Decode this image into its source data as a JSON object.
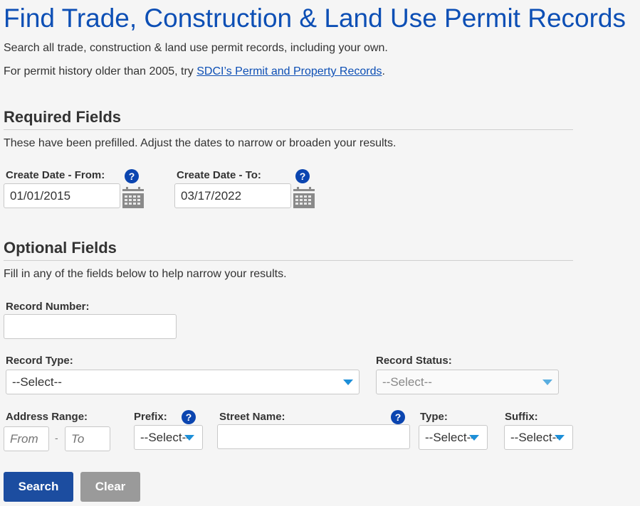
{
  "page": {
    "title": "Find Trade, Construction & Land Use Permit Records",
    "intro": "Search all trade, construction & land use permit records, including your own.",
    "history_prefix": "For permit history older than 2005, try ",
    "history_link": "SDCI’s Permit and Property Records",
    "history_suffix": "."
  },
  "required": {
    "heading": "Required Fields",
    "description": "These have been prefilled. Adjust the dates to narrow or broaden your results.",
    "date_from": {
      "label": "Create Date - From:",
      "value": "01/01/2015",
      "help_icon": "?"
    },
    "date_to": {
      "label": "Create Date - To:",
      "value": "03/17/2022",
      "help_icon": "?"
    }
  },
  "optional": {
    "heading": "Optional Fields",
    "description": "Fill in any of the fields below to help narrow your results.",
    "record_number": {
      "label": "Record Number:",
      "value": ""
    },
    "record_type": {
      "label": "Record Type:",
      "selected": "--Select--"
    },
    "record_status": {
      "label": "Record Status:",
      "selected": "--Select--"
    },
    "address_range": {
      "label": "Address Range:",
      "from_placeholder": "From",
      "to_placeholder": "To",
      "separator": "-"
    },
    "prefix": {
      "label": "Prefix:",
      "selected": "--Select--",
      "help_icon": "?"
    },
    "street_name": {
      "label": "Street Name:",
      "value": "",
      "help_icon": "?"
    },
    "type": {
      "label": "Type:",
      "selected": "--Select--"
    },
    "suffix": {
      "label": "Suffix:",
      "selected": "--Select--"
    }
  },
  "actions": {
    "search_label": "Search",
    "clear_label": "Clear"
  },
  "colors": {
    "title_blue": "#0d4fb5",
    "primary_button": "#1c4da0",
    "secondary_button": "#9a9a9a",
    "help_icon": "#0b45b0",
    "caret": "#1d8fd8"
  }
}
